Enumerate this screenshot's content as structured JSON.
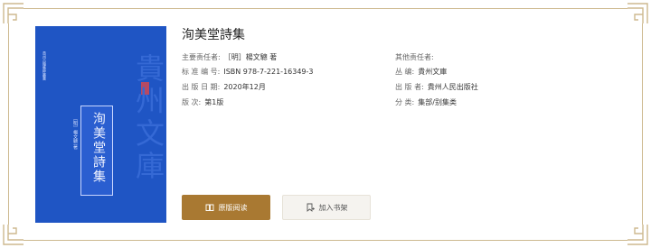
{
  "book": {
    "title": "洵美堂詩集",
    "cover": {
      "title_vertical": "洵美堂詩集",
      "series_vertical": "貴州文庫",
      "small_vertical": "［明］楊文驄 著",
      "strip_text": "貴州古籍集粹叢書",
      "colors": {
        "background": "#1f55c4",
        "accent_red": "#b64a63"
      }
    },
    "meta": {
      "left": [
        {
          "label": "主要责任者:",
          "value": "［明］楊文驄 著"
        },
        {
          "label": "标 准 编 号:",
          "value": "ISBN 978-7-221-16349-3"
        },
        {
          "label": "出 版 日 期:",
          "value": "2020年12月"
        },
        {
          "label": "版          次:",
          "value": "第1版"
        }
      ],
      "right": [
        {
          "label": "其他责任者:",
          "value": ""
        },
        {
          "label": "丛          编:",
          "value": "貴州文庫"
        },
        {
          "label": "出    版    者:",
          "value": "貴州人民出版社"
        },
        {
          "label": "分          类:",
          "value": "集部/别集类"
        }
      ]
    }
  },
  "actions": {
    "read_label": "原版阅读",
    "shelf_label": "加入书架",
    "read_icon": "book-open-icon",
    "shelf_icon": "bookmark-add-icon",
    "colors": {
      "read_bg": "#a97932",
      "shelf_bg": "#f5f3ef"
    }
  },
  "frame": {
    "line_color": "#cdb98f",
    "corner_icon": "fret-corner-ornament-icon"
  }
}
